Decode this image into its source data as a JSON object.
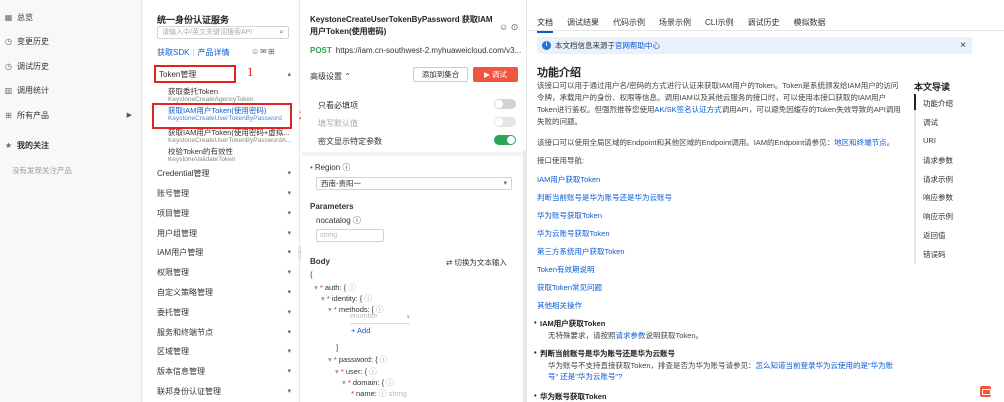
{
  "nav": {
    "items": [
      {
        "label": "总览",
        "icon": "grid-icon",
        "glyph": "▦"
      },
      {
        "label": "变更历史",
        "icon": "history-icon",
        "glyph": "◷"
      },
      {
        "label": "调试历史",
        "icon": "debug-history-icon",
        "glyph": "◷"
      },
      {
        "label": "调用统计",
        "icon": "chart-icon",
        "glyph": "▥"
      },
      {
        "label": "所有产品",
        "icon": "apps-icon",
        "glyph": "⊞"
      },
      {
        "label": "我的关注",
        "icon": "star-icon",
        "glyph": "★"
      }
    ],
    "empty_follow": "没有发现关注产品",
    "expand_arrow": "▶"
  },
  "product": {
    "title": "统一身份认证服务",
    "search_placeholder": "请输入中/英文关键词搜索API",
    "search_icon": "⌕",
    "sdk_link": "获取SDK",
    "detail_link": "产品详情",
    "tool_glyphs": "☺✉⊞",
    "token_group": "Token管理",
    "token_items": [
      {
        "cn": "获取委托Token",
        "en": "KeystoneCreateAgencyToken"
      },
      {
        "cn": "获取IAM用户Token(使用密码)",
        "en": "KeystoneCreateUserTokenByPassword"
      },
      {
        "cn": "获取IAM用户Token(使用密码+虚拟...",
        "en": "KeystoneCreateUserTokenByPasswordA..."
      },
      {
        "cn": "校验Token的有效性",
        "en": "KeystoneValidateToken"
      }
    ],
    "groups": [
      "Credential管理",
      "账号管理",
      "项目管理",
      "用户组管理",
      "IAM用户管理",
      "权限管理",
      "自定义策略管理",
      "委托管理",
      "服务和终端节点",
      "区域管理",
      "版本信息管理",
      "联邦身份认证管理"
    ],
    "caret_down": "▾",
    "caret_up": "▴",
    "annotations": {
      "one": "1",
      "two": "2"
    }
  },
  "debugger": {
    "title": "KeystoneCreateUserTokenByPassword 获取IAM用户Token(使用密码)",
    "icons": "☺ ⊙",
    "method": "POST",
    "url": "https://iam.cn-southwest-2.myhuaweicloud.com/v3...",
    "advanced": "高级设置 ⌃",
    "add_button": "添加到集合",
    "debug_button": "▶ 调试",
    "toggles": [
      {
        "label": "只看必填项",
        "on": false
      },
      {
        "label": "填写默认值",
        "on": false
      },
      {
        "label": "密文显示特定参数",
        "on": true
      }
    ],
    "region_label": "Region",
    "region_value": "西南-贵阳一",
    "params_label": "Parameters",
    "nocatalog_label": "nocatalog",
    "nocatalog_placeholder": "string",
    "body_label": "Body",
    "switch_text": "⇄ 切换为文本输入",
    "help_q": "ⓘ",
    "code": {
      "open_brace": "{",
      "auth": "auth: {",
      "identity": "identity: {",
      "methods": "methods: [",
      "enumber": "enumber",
      "add": "+ Add",
      "close_bracket": "]",
      "password": "password: {",
      "user": "user: {",
      "domain": "domain: {",
      "name": "name:",
      "name_placeholder": "string"
    }
  },
  "doc": {
    "tabs": [
      "文档",
      "调试结果",
      "代码示例",
      "场景示例",
      "CLI示例",
      "调试历史",
      "模拟数据"
    ],
    "notice": "本文档信息来源于",
    "notice_link": "官网帮助中心",
    "close": "×",
    "heading": "功能介绍",
    "para1_a": "该接口可以用于通过用户名/密码的方式进行认证来获取IAM用户的Token。Token是系统颁发给IAM用户的访问令牌，承载用户的身份、权限等信息。调用IAM以及其他云服务的接口时，可以使用本接口获取的IAM用户Token进行鉴权。但强烈推荐您使用",
    "para1_link": "AK/SK签名认证方式",
    "para1_b": "调用API，可以避免因缓存的Token失效导致的API调用失败的问题。",
    "para2_a": "该接口可以使用全局区域的Endpoint和其他区域的Endpoint调用。IAM的Endpoint请参见：",
    "para2_link": "地区和终端节点",
    "para2_b": "。",
    "guide": "接口使用导航:",
    "links": [
      "IAM用户获取Token",
      "判断当前账号是华为账号还是华为云账号",
      "华为账号获取Token",
      "华为云账号获取Token",
      "第三方系统用户获取Token",
      "Token有效期说明",
      "获取Token常见问题",
      "其他相关操作"
    ],
    "bullets": [
      {
        "title": "IAM用户获取Token",
        "desc_a": "无特殊要求，请按照",
        "desc_link": "请求参数",
        "desc_b": "说明获取Token。"
      },
      {
        "title": "判断当前账号是华为账号还是华为云账号",
        "desc_a": "华为账号不支持直接获取Token，排查是否为华为账号请参见：",
        "desc_link": "怎么知道当前登录华为云使用的是\"华为账号\" 还是\"华为云账号\"?",
        "desc_b": ""
      },
      {
        "title": "华为账号获取Token",
        "desc_a": "",
        "desc_link": "",
        "desc_b": ""
      }
    ],
    "toc_title": "本文导读",
    "toc": [
      "功能介绍",
      "调试",
      "URI",
      "请求参数",
      "请求示例",
      "响应参数",
      "响应示例",
      "返回值",
      "错误码"
    ]
  },
  "colors": {
    "accent": "#0a5bd3",
    "danger": "#f0553d",
    "annotation": "#e52222",
    "success": "#2ca358"
  }
}
